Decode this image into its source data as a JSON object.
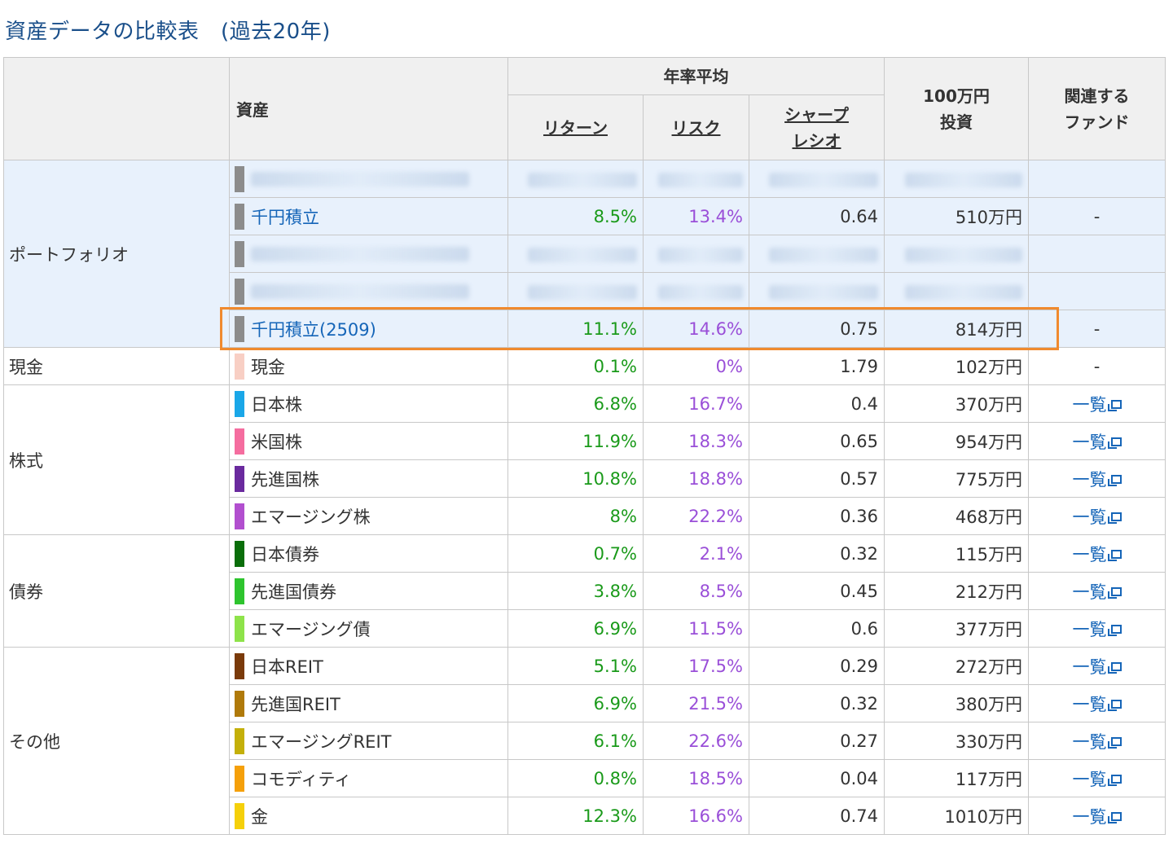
{
  "title": "資産データの比較表　(過去20年)",
  "header": {
    "asset": "資産",
    "annual_avg": "年率平均",
    "return_label": "リターン",
    "risk_label": "リスク",
    "sharpe_line1": "シャープ",
    "sharpe_line2": "レシオ",
    "invest_line1": "100万円",
    "invest_line2": "投資",
    "fund_line1": "関連する",
    "fund_line2": "ファンド"
  },
  "colors": {
    "return": "#1a9a1a",
    "risk": "#9a4fd8",
    "link": "#1565b8",
    "highlight_border": "#f08a2e",
    "portfolio_bg": "#e8f1fc"
  },
  "categories": {
    "portfolio": "ポートフォリオ",
    "cash": "現金",
    "stocks": "株式",
    "bonds": "債券",
    "other": "その他"
  },
  "rows": [
    {
      "name": "",
      "color": "#8c8c8c",
      "blurred": true
    },
    {
      "name": "千円積立",
      "color": "#8c8c8c",
      "ret": "8.5%",
      "risk": "13.4%",
      "sharpe": "0.64",
      "invest": "510万円",
      "fund": "-"
    },
    {
      "name": "",
      "color": "#8c8c8c",
      "blurred": true
    },
    {
      "name": "",
      "color": "#8c8c8c",
      "blurred": true
    },
    {
      "name": "千円積立(2509)",
      "color": "#8c8c8c",
      "ret": "11.1%",
      "risk": "14.6%",
      "sharpe": "0.75",
      "invest": "814万円",
      "fund": "-"
    },
    {
      "name": "現金",
      "color": "#f8cfc4",
      "ret": "0.1%",
      "risk": "0%",
      "sharpe": "1.79",
      "invest": "102万円",
      "fund": "-"
    },
    {
      "name": "日本株",
      "color": "#1aa7e8",
      "ret": "6.8%",
      "risk": "16.7%",
      "sharpe": "0.4",
      "invest": "370万円",
      "fund": "一覧"
    },
    {
      "name": "米国株",
      "color": "#f56d9f",
      "ret": "11.9%",
      "risk": "18.3%",
      "sharpe": "0.65",
      "invest": "954万円",
      "fund": "一覧"
    },
    {
      "name": "先進国株",
      "color": "#6a2a9e",
      "ret": "10.8%",
      "risk": "18.8%",
      "sharpe": "0.57",
      "invest": "775万円",
      "fund": "一覧"
    },
    {
      "name": "エマージング株",
      "color": "#b24fcf",
      "ret": "8%",
      "risk": "22.2%",
      "sharpe": "0.36",
      "invest": "468万円",
      "fund": "一覧"
    },
    {
      "name": "日本債券",
      "color": "#0a6e0a",
      "ret": "0.7%",
      "risk": "2.1%",
      "sharpe": "0.32",
      "invest": "115万円",
      "fund": "一覧"
    },
    {
      "name": "先進国債券",
      "color": "#2ec42e",
      "ret": "3.8%",
      "risk": "8.5%",
      "sharpe": "0.45",
      "invest": "212万円",
      "fund": "一覧"
    },
    {
      "name": "エマージング債",
      "color": "#8ee34a",
      "ret": "6.9%",
      "risk": "11.5%",
      "sharpe": "0.6",
      "invest": "377万円",
      "fund": "一覧"
    },
    {
      "name": "日本REIT",
      "color": "#7a3a0a",
      "ret": "5.1%",
      "risk": "17.5%",
      "sharpe": "0.29",
      "invest": "272万円",
      "fund": "一覧"
    },
    {
      "name": "先進国REIT",
      "color": "#b07a0a",
      "ret": "6.9%",
      "risk": "21.5%",
      "sharpe": "0.32",
      "invest": "380万円",
      "fund": "一覧"
    },
    {
      "name": "エマージングREIT",
      "color": "#c4b00a",
      "ret": "6.1%",
      "risk": "22.6%",
      "sharpe": "0.27",
      "invest": "330万円",
      "fund": "一覧"
    },
    {
      "name": "コモディティ",
      "color": "#f5a00a",
      "ret": "0.8%",
      "risk": "18.5%",
      "sharpe": "0.04",
      "invest": "117万円",
      "fund": "一覧"
    },
    {
      "name": "金",
      "color": "#f5d00a",
      "ret": "12.3%",
      "risk": "16.6%",
      "sharpe": "0.74",
      "invest": "1010万円",
      "fund": "一覧"
    }
  ]
}
